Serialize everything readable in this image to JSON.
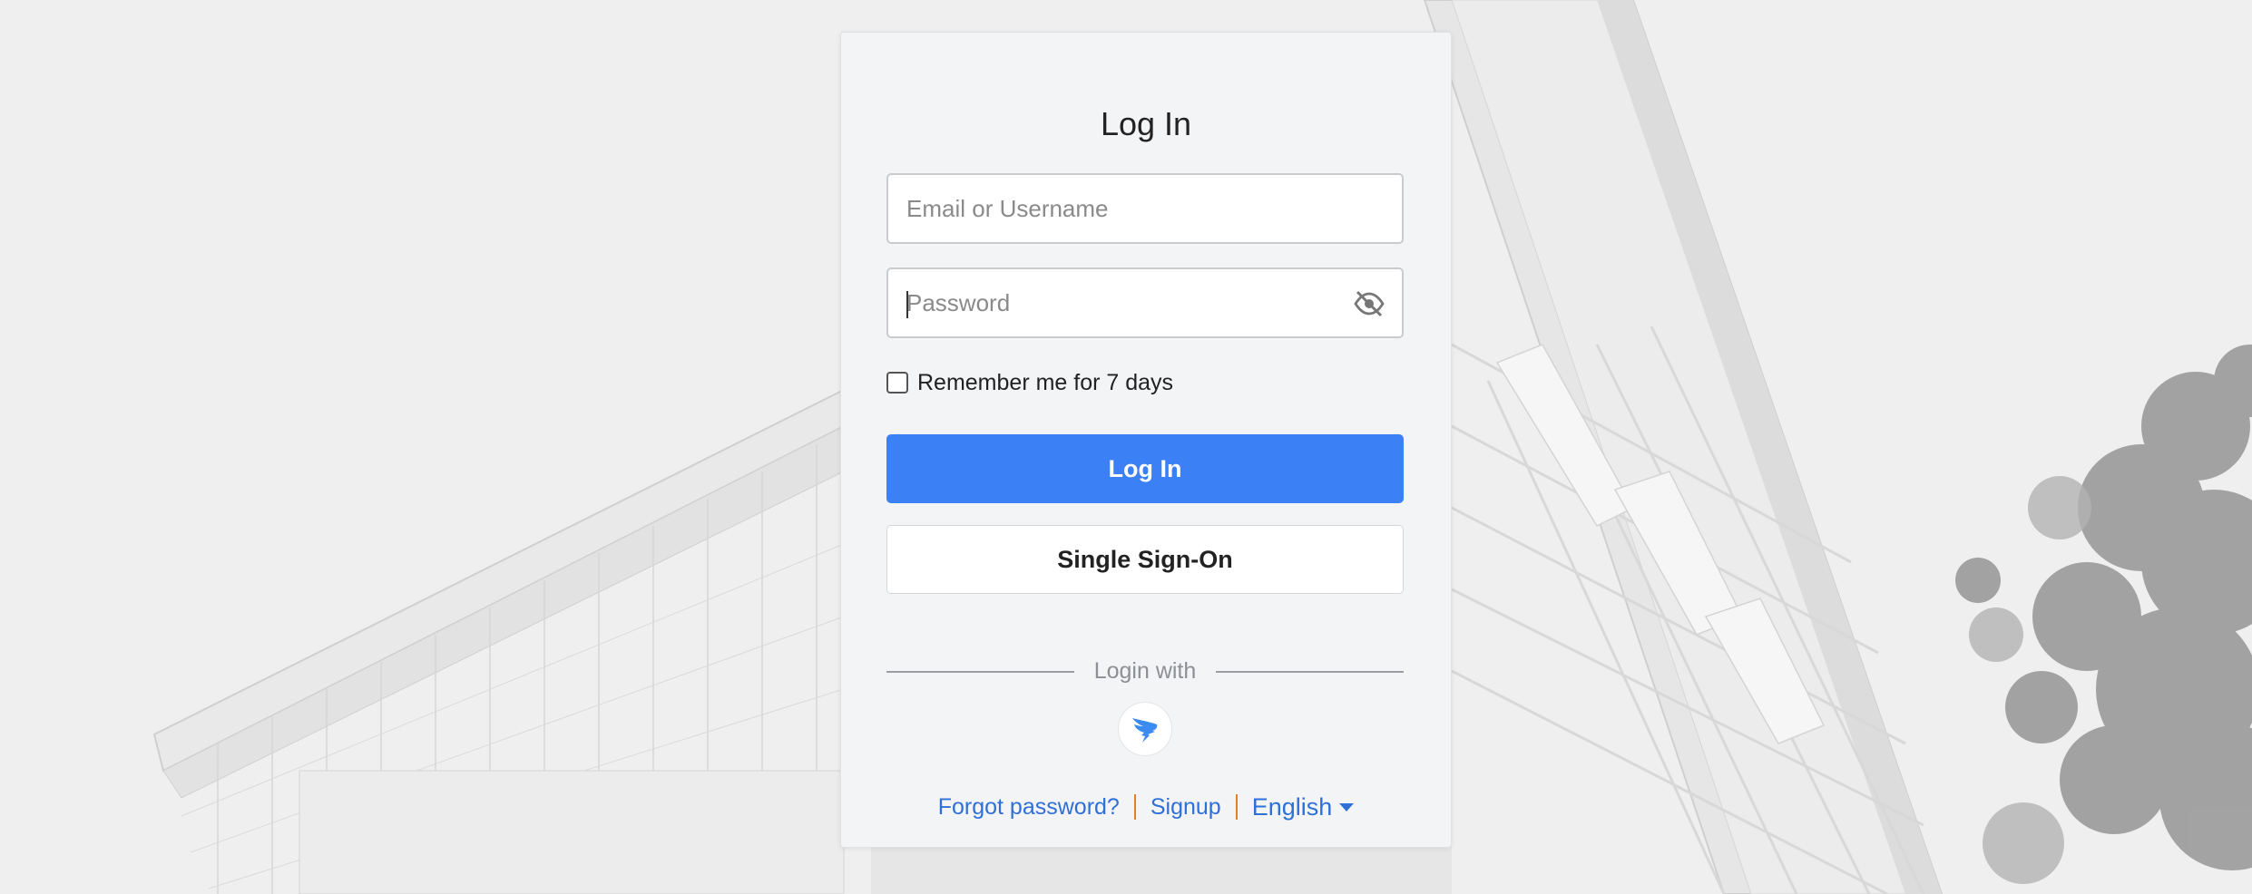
{
  "page": {
    "title": "Log In"
  },
  "form": {
    "email_placeholder": "Email or Username",
    "email_value": "",
    "password_placeholder": "Password",
    "password_value": "",
    "remember_label": "Remember me for 7 days",
    "remember_checked": false
  },
  "buttons": {
    "login_label": "Log In",
    "sso_label": "Single Sign-On"
  },
  "social": {
    "divider_text": "Login with",
    "providers": [
      {
        "name": "DingTalk",
        "icon": "dingtalk-icon",
        "color": "#3b8bf0"
      }
    ]
  },
  "footer": {
    "forgot_label": "Forgot password?",
    "signup_label": "Signup",
    "language_label": "English"
  },
  "colors": {
    "primary": "#3b80f4",
    "link": "#2f6fd6",
    "separator": "#d9822b"
  }
}
